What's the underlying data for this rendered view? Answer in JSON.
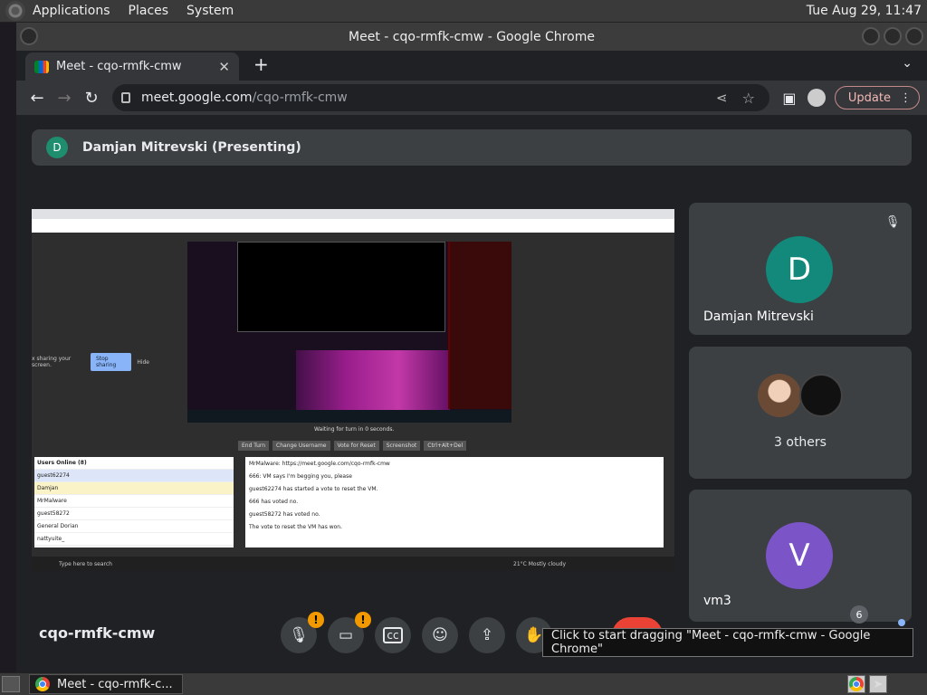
{
  "top_panel": {
    "menus": [
      "Applications",
      "Places",
      "System"
    ],
    "clock": "Tue Aug 29, 11:47"
  },
  "window": {
    "title": "Meet - cqo-rmfk-cmw - Google Chrome"
  },
  "browser": {
    "tab_title": "Meet - cqo-rmfk-cmw",
    "url_host": "meet.google.com",
    "url_path": "/cqo-rmfk-cmw",
    "update_label": "Update"
  },
  "meet": {
    "presenter_initial": "D",
    "presenting_label": "Damjan Mitrevski (Presenting)",
    "meeting_code": "cqo-rmfk-cmw",
    "participant_count": "6",
    "tiles": [
      {
        "initial": "D",
        "name": "Damjan Mitrevski",
        "color": "#12897a"
      },
      {
        "label": "3 others"
      },
      {
        "initial": "V",
        "name": "vm3",
        "color": "#7b55c7"
      }
    ],
    "badges": {
      "mic": "!",
      "cam": "!"
    }
  },
  "shared_screen": {
    "sharing_text": "x sharing your screen.",
    "stop_sharing": "Stop sharing",
    "hide": "Hide",
    "wait_text": "Waiting for turn in 0 seconds.",
    "buttons": [
      "End Turn",
      "Change Username",
      "Vote for Reset",
      "Screenshot",
      "Ctrl+Alt+Del"
    ],
    "users_header": "Users Online (8)",
    "users": [
      "guest62274",
      "Damjan",
      "MrMalware",
      "guest58272",
      "General Dorian",
      "nattyuite_"
    ],
    "chat": [
      "MrMalware: https://meet.google.com/cqo-rmfk-cmw",
      "666: VM says I'm begging you, please",
      "guest62274 has started a vote to reset the VM.",
      "666 has voted no.",
      "guest58272 has voted no.",
      "The vote to reset the VM has won."
    ],
    "weather": "21°C  Mostly cloudy",
    "search_placeholder": "Type here to search"
  },
  "tooltip": "Click to start dragging \"Meet - cqo-rmfk-cmw - Google Chrome\"",
  "taskbar": {
    "task_label": "Meet - cqo-rmfk-c..."
  }
}
